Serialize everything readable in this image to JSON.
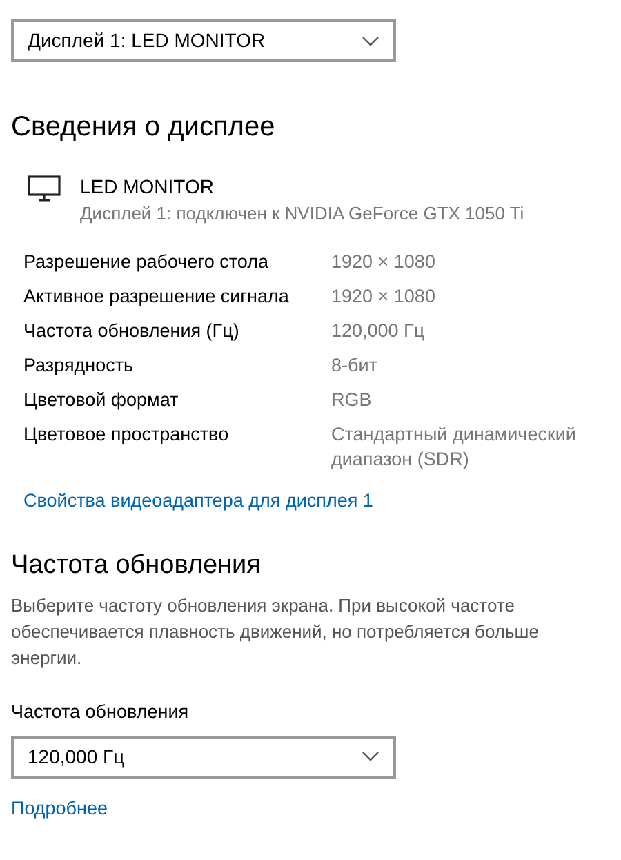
{
  "display_select": {
    "value": "Дисплей 1: LED MONITOR"
  },
  "display_info": {
    "heading": "Сведения о дисплее",
    "monitor_name": "LED MONITOR",
    "connection": "Дисплей 1: подключен к NVIDIA GeForce GTX 1050 Ti",
    "rows": [
      {
        "label": "Разрешение рабочего стола",
        "value": "1920 × 1080"
      },
      {
        "label": "Активное разрешение сигнала",
        "value": "1920 × 1080"
      },
      {
        "label": "Частота обновления (Гц)",
        "value": "120,000 Гц"
      },
      {
        "label": "Разрядность",
        "value": "8-бит"
      },
      {
        "label": "Цветовой формат",
        "value": "RGB"
      },
      {
        "label": "Цветовое пространство",
        "value": "Стандартный динамический диапазон (SDR)"
      }
    ],
    "link": "Свойства видеоадаптера для дисплея 1"
  },
  "refresh_rate": {
    "heading": "Частота обновления",
    "description": "Выберите частоту обновления экрана. При высокой частоте обеспечивается плавность движений, но потребляется больше энергии.",
    "label": "Частота обновления",
    "select_value": "120,000 Гц",
    "link": "Подробнее"
  }
}
